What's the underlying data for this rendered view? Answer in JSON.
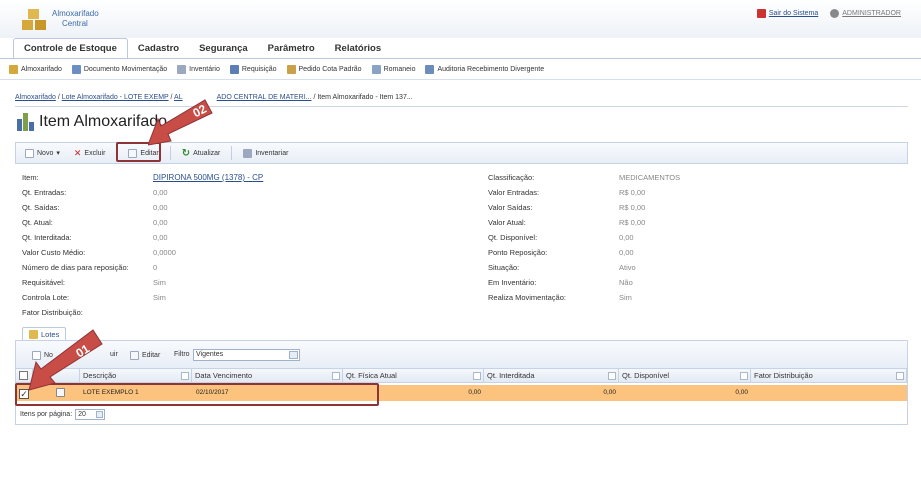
{
  "app": {
    "title_line1": "Almoxarifado",
    "title_line2": "Central"
  },
  "topright": {
    "exit": "Sair do Sistema",
    "user": "ADMINISTRADOR"
  },
  "tabs": [
    {
      "label": "Controle de Estoque"
    },
    {
      "label": "Cadastro"
    },
    {
      "label": "Segurança"
    },
    {
      "label": "Parâmetro"
    },
    {
      "label": "Relatórios"
    }
  ],
  "menu": [
    {
      "label": "Almoxarifado"
    },
    {
      "label": "Documento Movimentação"
    },
    {
      "label": "Inventário"
    },
    {
      "label": "Requisição"
    },
    {
      "label": "Pedido Cota Padrão"
    },
    {
      "label": "Romaneio"
    },
    {
      "label": "Auditoria Recebimento Divergente"
    }
  ],
  "breadcrumb": {
    "c1": "Almoxarifado",
    "c2": "Lote Almoxarifado - LOTE EXEMP",
    "c3": "AL",
    "c3b": "ADO CENTRAL DE MATERI...",
    "c4": "Item Almoxarifado - Item 137..."
  },
  "page_title": "Item Almoxarifado",
  "toolbar": {
    "new": "Novo",
    "delete": "Excluir",
    "edit": "Editar",
    "refresh": "Atualizar",
    "inventory": "Inventariar"
  },
  "fields_left": [
    {
      "label": "Item:",
      "value": "DIPIRONA 500MG (1378) - CP"
    },
    {
      "label": "Qt. Entradas:",
      "value": "0,00"
    },
    {
      "label": "Qt. Saídas:",
      "value": "0,00"
    },
    {
      "label": "Qt. Atual:",
      "value": "0,00"
    },
    {
      "label": "Qt. Interditada:",
      "value": "0,00"
    },
    {
      "label": "Valor Custo Médio:",
      "value": "0,0000"
    },
    {
      "label": "Número de dias para reposição:",
      "value": "0"
    },
    {
      "label": "Requisitável:",
      "value": "Sim"
    },
    {
      "label": "Controla Lote:",
      "value": "Sim"
    },
    {
      "label": "Fator Distribuição:",
      "value": ""
    }
  ],
  "fields_right": [
    {
      "label": "Classificação:",
      "value": "MEDICAMENTOS"
    },
    {
      "label": "Valor Entradas:",
      "value": "R$ 0,00"
    },
    {
      "label": "Valor Saídas:",
      "value": "R$ 0,00"
    },
    {
      "label": "Valor Atual:",
      "value": "R$ 0,00"
    },
    {
      "label": "Qt. Disponível:",
      "value": "0,00"
    },
    {
      "label": "Ponto Reposição:",
      "value": "0,00"
    },
    {
      "label": "Situação:",
      "value": "Ativo"
    },
    {
      "label": "Em Inventário:",
      "value": "Não"
    },
    {
      "label": "Realiza Movimentação:",
      "value": "Sim"
    }
  ],
  "lotes": {
    "tab": "Lotes",
    "new": "No",
    "delete": "uir",
    "edit": "Editar",
    "filter_label": "Filtro",
    "filter_value": "Vigentes",
    "columns": [
      "Descrição",
      "Data Vencimento",
      "Qt. Física Atual",
      "Qt. Interditada",
      "Qt. Disponível",
      "Fator Distribuição"
    ],
    "rows": [
      {
        "descricao": "LOTE EXEMPLO 1",
        "vencimento": "02/10/2017",
        "fisica": "0,00",
        "interditada": "0,00",
        "disponivel": "0,00",
        "fator": ""
      }
    ],
    "per_page_label": "Itens por página:",
    "per_page": "20"
  },
  "annotations": {
    "a1": "01",
    "a2": "02"
  },
  "colors": {
    "highlight": "#8e3437",
    "row_selected": "#fbc37e",
    "link": "#2b4f8c"
  }
}
